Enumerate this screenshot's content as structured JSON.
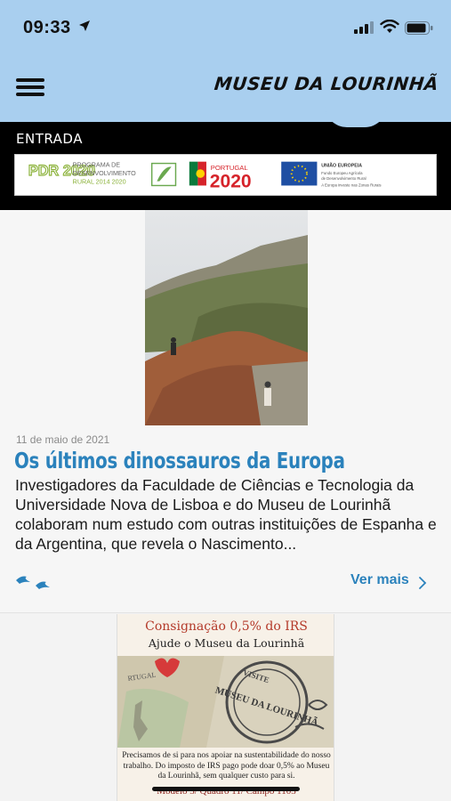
{
  "status_bar": {
    "time": "09:33"
  },
  "app_bar": {
    "brand": "MUSEU DA LOURINHÃ",
    "menu_icon": "hamburger-menu-icon"
  },
  "section": {
    "title": "ENTRADA"
  },
  "funding_banner": {
    "pdr_mark": "PDR 2020",
    "pdr_text_line1": "PROGRAMA DE",
    "pdr_text_line2": "DESENVOLVIMENTO",
    "pdr_text_line3": "RURAL 2014 2020",
    "portugal_label": "PORTUGAL",
    "portugal_year": "2020",
    "eu_title": "UNIÃO EUROPEIA",
    "eu_line1": "Fundo Europeu Agrícola",
    "eu_line2": "de Desenvolvimento Rural",
    "eu_line3": "A Europa investe nas Zonas Rurais"
  },
  "article": {
    "date": "11 de maio de 2021",
    "title": "Os últimos dinossauros da Europa",
    "excerpt": "Investigadores da Faculdade de Ciências e Tecnologia da Universidade Nova de Lisboa e do Museu de Lourinhã colaboram num estudo com outras instituições de Espanha e da Argentina, que revela o Nascimento...",
    "read_more": "Ver mais"
  },
  "poster": {
    "title": "Consignação 0,5% do IRS",
    "subtitle": "Ajude o Museu da Lourinhã",
    "stamp_top": "VISITE",
    "stamp_main": "MUSEU DA LOURINHÃ",
    "postal_label": "RTUGAL",
    "body": "Precisamos de si para nos apoiar na sustentabilidade do nosso trabalho. Do imposto de IRS pago pode doar 0,5% ao Museu da Lourinhã, sem qualquer custo para si.",
    "model": "Modelo 3/ Quadro 11/ Campo 1103"
  },
  "colors": {
    "header": "#a9cfef",
    "accent": "#2b82bc",
    "section": "#000000"
  }
}
